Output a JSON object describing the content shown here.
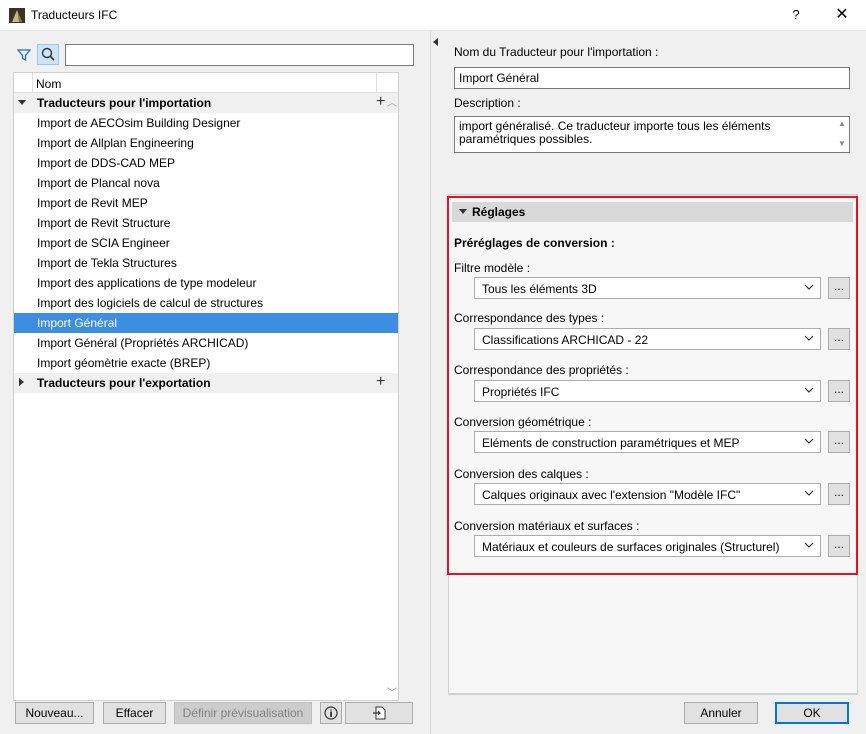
{
  "window": {
    "title": "Traducteurs IFC",
    "help": "?",
    "close": "✕"
  },
  "search": {
    "value": "",
    "placeholder": ""
  },
  "list": {
    "column_header": "Nom",
    "rows": [
      {
        "label": "Traducteurs pour l'importation",
        "type": "group-open"
      },
      {
        "label": "Import de AECOsim Building Designer"
      },
      {
        "label": "Import de Allplan Engineering"
      },
      {
        "label": "Import de DDS-CAD MEP"
      },
      {
        "label": "Import de Plancal nova"
      },
      {
        "label": "Import de Revit MEP"
      },
      {
        "label": "Import de Revit Structure"
      },
      {
        "label": "Import de SCIA Engineer"
      },
      {
        "label": "Import de Tekla Structures"
      },
      {
        "label": "Import des applications de type modeleur"
      },
      {
        "label": "Import des logiciels de calcul de structures"
      },
      {
        "label": "Import Général",
        "selected": true
      },
      {
        "label": "Import Général (Propriétés ARCHICAD)"
      },
      {
        "label": "Import géomètrie exacte (BREP)"
      },
      {
        "label": "Traducteurs pour l'exportation",
        "type": "group-closed"
      }
    ]
  },
  "left_buttons": {
    "new": "Nouveau...",
    "delete": "Effacer",
    "preview": "Définir prévisualisation",
    "info": "i"
  },
  "right": {
    "name_label": "Nom du Traducteur pour l'importation :",
    "name_value": "Import Général",
    "desc_label": "Description :",
    "desc_line1": "import généralisé. Ce traducteur importe tous les éléments",
    "desc_line2": "paramétriques possibles.",
    "settings_header": "Réglages",
    "presets_label": "Préréglages de conversion :",
    "settings": [
      {
        "label": "Filtre modèle :",
        "value": "Tous les éléments 3D"
      },
      {
        "label": "Correspondance des types :",
        "value": "Classifications ARCHICAD - 22"
      },
      {
        "label": "Correspondance des propriétés :",
        "value": "Propriétés IFC"
      },
      {
        "label": "Conversion géométrique :",
        "value": "Eléments de construction paramétriques et MEP"
      },
      {
        "label": "Conversion des calques :",
        "value": "Calques originaux avec l'extension \"Modèle IFC\""
      },
      {
        "label": "Conversion matériaux et surfaces :",
        "value": "Matériaux et couleurs de surfaces originales (Structurel)"
      }
    ],
    "dots": "..."
  },
  "footer": {
    "cancel": "Annuler",
    "ok": "OK"
  },
  "colors": {
    "selection": "#3d8ee0",
    "highlight": "#e81123",
    "primary_border": "#0078d7"
  }
}
